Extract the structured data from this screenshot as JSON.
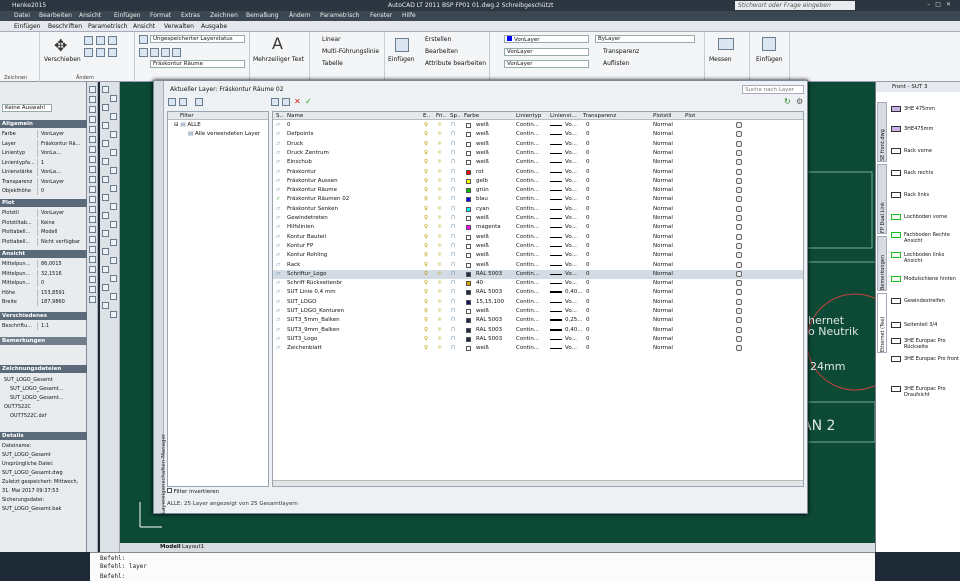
{
  "window": {
    "doc_tab": "Henke2015",
    "title": "AutoCAD LT 2011    BSP FP01 01.dwg.2    Schreibgeschützt",
    "help_placeholder": "Stichwort oder Frage eingeben"
  },
  "menu": [
    "Datei",
    "Bearbeiten",
    "Ansicht",
    "Einfügen",
    "Format",
    "Extras",
    "Zeichnen",
    "Bemaßung",
    "Ändern",
    "Parametrisch",
    "Fenster",
    "Hilfe"
  ],
  "ribbon_tabs": [
    "Einfügen",
    "Beschriften",
    "Parametrisch",
    "Ansicht",
    "Verwalten",
    "Ausgabe"
  ],
  "ribbon": {
    "verschieben": "Verschieben",
    "ungespeichert": "Ungespeicherter Layerstatus",
    "frastkontur": "Fräskontur Räume",
    "mehrzeilig": "Mehrzeiliger Text",
    "linear": "Linear",
    "multi": "Multi-Führungslinie",
    "tabelle": "Tabelle",
    "einfuegen": "Einfügen",
    "erstellen": "Erstellen",
    "bearbeiten": "Bearbeiten",
    "attribute": "Attribute bearbeiten",
    "vonlayer1": "VonLayer",
    "vonlayer2": "VonLayer",
    "vonlayer3": "VonLayer",
    "bylayer": "ByLayer",
    "transparenz": "Transparenz",
    "auflisten": "Auflisten",
    "messen": "Messen",
    "einfuegen2": "Einfügen",
    "zeichnen_lbl": "Zeichnen",
    "aendern_lbl": "Ändern"
  },
  "left_panel": {
    "sel": "Keine Auswahl",
    "allgemein": "Allgemein",
    "general": [
      [
        "Farbe",
        "VonLayer"
      ],
      [
        "Layer",
        "Fräskontur Rä..."
      ],
      [
        "Linientyp",
        "VonLa..."
      ],
      [
        "Linientypfa...",
        "1"
      ],
      [
        "Linienstärke",
        "VonLa..."
      ],
      [
        "Transparenz",
        "VonLayer"
      ],
      [
        "Objekthöhe",
        "0"
      ]
    ],
    "plot": "Plot",
    "plotrows": [
      [
        "Plotstil",
        "VonLayer"
      ],
      [
        "Plotstiltab...",
        "Keine"
      ],
      [
        "Plottabell...",
        "Modell"
      ],
      [
        "Plottabell...",
        "Nicht verfügbar"
      ]
    ],
    "ansicht": "Ansicht",
    "viewrows": [
      [
        "Mittelpun...",
        "86,0015"
      ],
      [
        "Mittelpun...",
        "32,1516"
      ],
      [
        "Mittelpun...",
        "0"
      ],
      [
        "Höhe",
        "153,8591"
      ],
      [
        "Breite",
        "187,9860"
      ]
    ],
    "versch": "Verschiedenes",
    "verschrow": [
      [
        "Beschriftu...",
        "1:1"
      ]
    ],
    "bem": "Bemerkungen",
    "files_hdr": "Zeichnungsdateien",
    "files": [
      "SUT_LOGO_Gesamt",
      "SUT_LOGO_Gesamt...",
      "SUT_LOGO_Gesamt...",
      "OUT7522C",
      "OUT7522C.dxf"
    ],
    "details_hdr": "Details",
    "details": [
      "Dateiname:",
      "SUT_LOGO_Gesamt",
      "Ursprüngliche Datei:",
      "SUT_LOGO_Gesamt.dwg",
      "Zuletzt gespeichert: Mittwoch,",
      "31. Mai 2017 09:37:53",
      "Sicherungsdatei:",
      "SUT_LOGO_Gesamt.bak"
    ]
  },
  "canvas": {
    "t1": "hernet",
    "t2": "o Neutrik",
    "t3": "24mm",
    "t4": "AN 2"
  },
  "canvas_tabs": [
    "Modell",
    "Layout1"
  ],
  "command": [
    "Befehl:",
    "Befehl: layer",
    "Befehl:"
  ],
  "dialog": {
    "current": "Aktueller Layer: Fräskontur Räume 02",
    "search": "Suche nach Layer",
    "side": "Layereigenschaften-Manager",
    "tree_hd": "Filter",
    "tree": [
      "ALLE",
      "Alle verwendeten Layer"
    ],
    "filter_invert": "Filter invertieren",
    "status": "ALLE: 25 Layer angezeigt von 25 Gesamtlayern",
    "cols": [
      "S..",
      "Name",
      "E..",
      "Fri..",
      "Sp..",
      "Farbe",
      "Linientyp",
      "Linienst...",
      "Transparenz",
      "Plotstil",
      "Plot"
    ],
    "rows": [
      {
        "n": "0",
        "c": "weiß",
        "h": "#ffffff",
        "lt": "Contin...",
        "lw": "Vo...",
        "t": "0",
        "ps": "Normal"
      },
      {
        "n": "Defpoints",
        "c": "weiß",
        "h": "#ffffff",
        "lt": "Contin...",
        "lw": "Vo...",
        "t": "0",
        "ps": "Normal"
      },
      {
        "n": "Druck",
        "c": "weiß",
        "h": "#ffffff",
        "lt": "Contin...",
        "lw": "Vo...",
        "t": "0",
        "ps": "Normal"
      },
      {
        "n": "Druck Zentrum",
        "c": "weiß",
        "h": "#ffffff",
        "lt": "Contin...",
        "lw": "Vo...",
        "t": "0",
        "ps": "Normal"
      },
      {
        "n": "Einschub",
        "c": "weiß",
        "h": "#ffffff",
        "lt": "Contin...",
        "lw": "Vo...",
        "t": "0",
        "ps": "Normal"
      },
      {
        "n": "Fräskontur",
        "c": "rot",
        "h": "#ff0000",
        "lt": "Contin...",
        "lw": "Vo...",
        "t": "0",
        "ps": "Normal"
      },
      {
        "n": "Fräskontur Aussen",
        "c": "gelb",
        "h": "#ffff00",
        "lt": "Contin...",
        "lw": "Vo...",
        "t": "0",
        "ps": "Normal"
      },
      {
        "n": "Fräskontur Räume",
        "c": "grün",
        "h": "#00c000",
        "lt": "Contin...",
        "lw": "Vo...",
        "t": "0",
        "ps": "Normal"
      },
      {
        "n": "Fräskontur Räumen 02",
        "c": "blau",
        "h": "#0000ff",
        "lt": "Contin...",
        "lw": "Vo...",
        "t": "0",
        "ps": "Normal",
        "cur": true
      },
      {
        "n": "Fräskontur Senken",
        "c": "cyan",
        "h": "#00ffff",
        "lt": "Contin...",
        "lw": "Vo...",
        "t": "0",
        "ps": "Normal"
      },
      {
        "n": "Gewindetreten",
        "c": "weiß",
        "h": "#ffffff",
        "lt": "Contin...",
        "lw": "Vo...",
        "t": "0",
        "ps": "Normal"
      },
      {
        "n": "Hilfslinien",
        "c": "magenta",
        "h": "#ff00ff",
        "lt": "Contin...",
        "lw": "Vo...",
        "t": "0",
        "ps": "Normal"
      },
      {
        "n": "Kontur Bauteil",
        "c": "weiß",
        "h": "#ffffff",
        "lt": "Contin...",
        "lw": "Vo...",
        "t": "0",
        "ps": "Normal"
      },
      {
        "n": "Kontur FP",
        "c": "weiß",
        "h": "#ffffff",
        "lt": "Contin...",
        "lw": "Vo...",
        "t": "0",
        "ps": "Normal"
      },
      {
        "n": "Kontur Rohling",
        "c": "weiß",
        "h": "#ffffff",
        "lt": "Contin...",
        "lw": "Vo...",
        "t": "0",
        "ps": "Normal"
      },
      {
        "n": "Rack",
        "c": "weiß",
        "h": "#ffffff",
        "lt": "Contin...",
        "lw": "Vo...",
        "t": "0",
        "ps": "Normal"
      },
      {
        "n": "Schriftur_Logo",
        "c": "RAL 5003",
        "h": "#1e2b48",
        "lt": "Contin...",
        "lw": "Vo...",
        "t": "0",
        "ps": "Normal",
        "sel": true
      },
      {
        "n": "Schriff Rückseitenbr",
        "c": "40",
        "h": "#d4a400",
        "lt": "Contin...",
        "lw": "Vo...",
        "t": "0",
        "ps": "Normal"
      },
      {
        "n": "SUT Linie 0,4 mm",
        "c": "RAL 5003",
        "h": "#1e2b48",
        "lt": "Contin...",
        "lw": "0,40...",
        "t": "0",
        "ps": "Normal",
        "thick": true
      },
      {
        "n": "SUT_LOGO",
        "c": "15,15,100",
        "h": "#0f0f64",
        "lt": "Contin...",
        "lw": "Vo...",
        "t": "0",
        "ps": "Normal"
      },
      {
        "n": "SUT_LOGO_Konturen",
        "c": "weiß",
        "h": "#ffffff",
        "lt": "Contin...",
        "lw": "Vo...",
        "t": "0",
        "ps": "Normal"
      },
      {
        "n": "SUT3_5mm_Balken",
        "c": "RAL 5003",
        "h": "#1e2b48",
        "lt": "Contin...",
        "lw": "0,25...",
        "t": "0",
        "ps": "Normal",
        "thick": true
      },
      {
        "n": "SUT3_9mm_Balken",
        "c": "RAL 5003",
        "h": "#1e2b48",
        "lt": "Contin...",
        "lw": "0,40...",
        "t": "0",
        "ps": "Normal",
        "thick": true
      },
      {
        "n": "SUT3_Logo",
        "c": "RAL 5003",
        "h": "#1e2b48",
        "lt": "Contin...",
        "lw": "Vo...",
        "t": "0",
        "ps": "Normal"
      },
      {
        "n": "Zeichenblatt",
        "c": "weiß",
        "h": "#ffffff",
        "lt": "Contin...",
        "lw": "Vo...",
        "t": "0",
        "ps": "Normal"
      }
    ]
  },
  "right_panel": {
    "title": "Front - SUT 3",
    "tabs": [
      "SE front.dwg",
      "FP Dual Link",
      "Bemerkungen",
      "Ethernet (Tee)"
    ],
    "items": [
      "3HE 475mm",
      "3HE475mm",
      "Rack vorne",
      "Rack rechts",
      "Rack links",
      "Lochboden vorne",
      "Fachboden Rechte Ansicht",
      "Lochboden links Ansicht",
      "Modulschiene hinten",
      "Gewindestreifen",
      "Seitenteil 3/4",
      "3HE Europac Pro Rückseite",
      "3HE Europac Pro front",
      "3HE Europac Pro Draufsicht"
    ]
  }
}
